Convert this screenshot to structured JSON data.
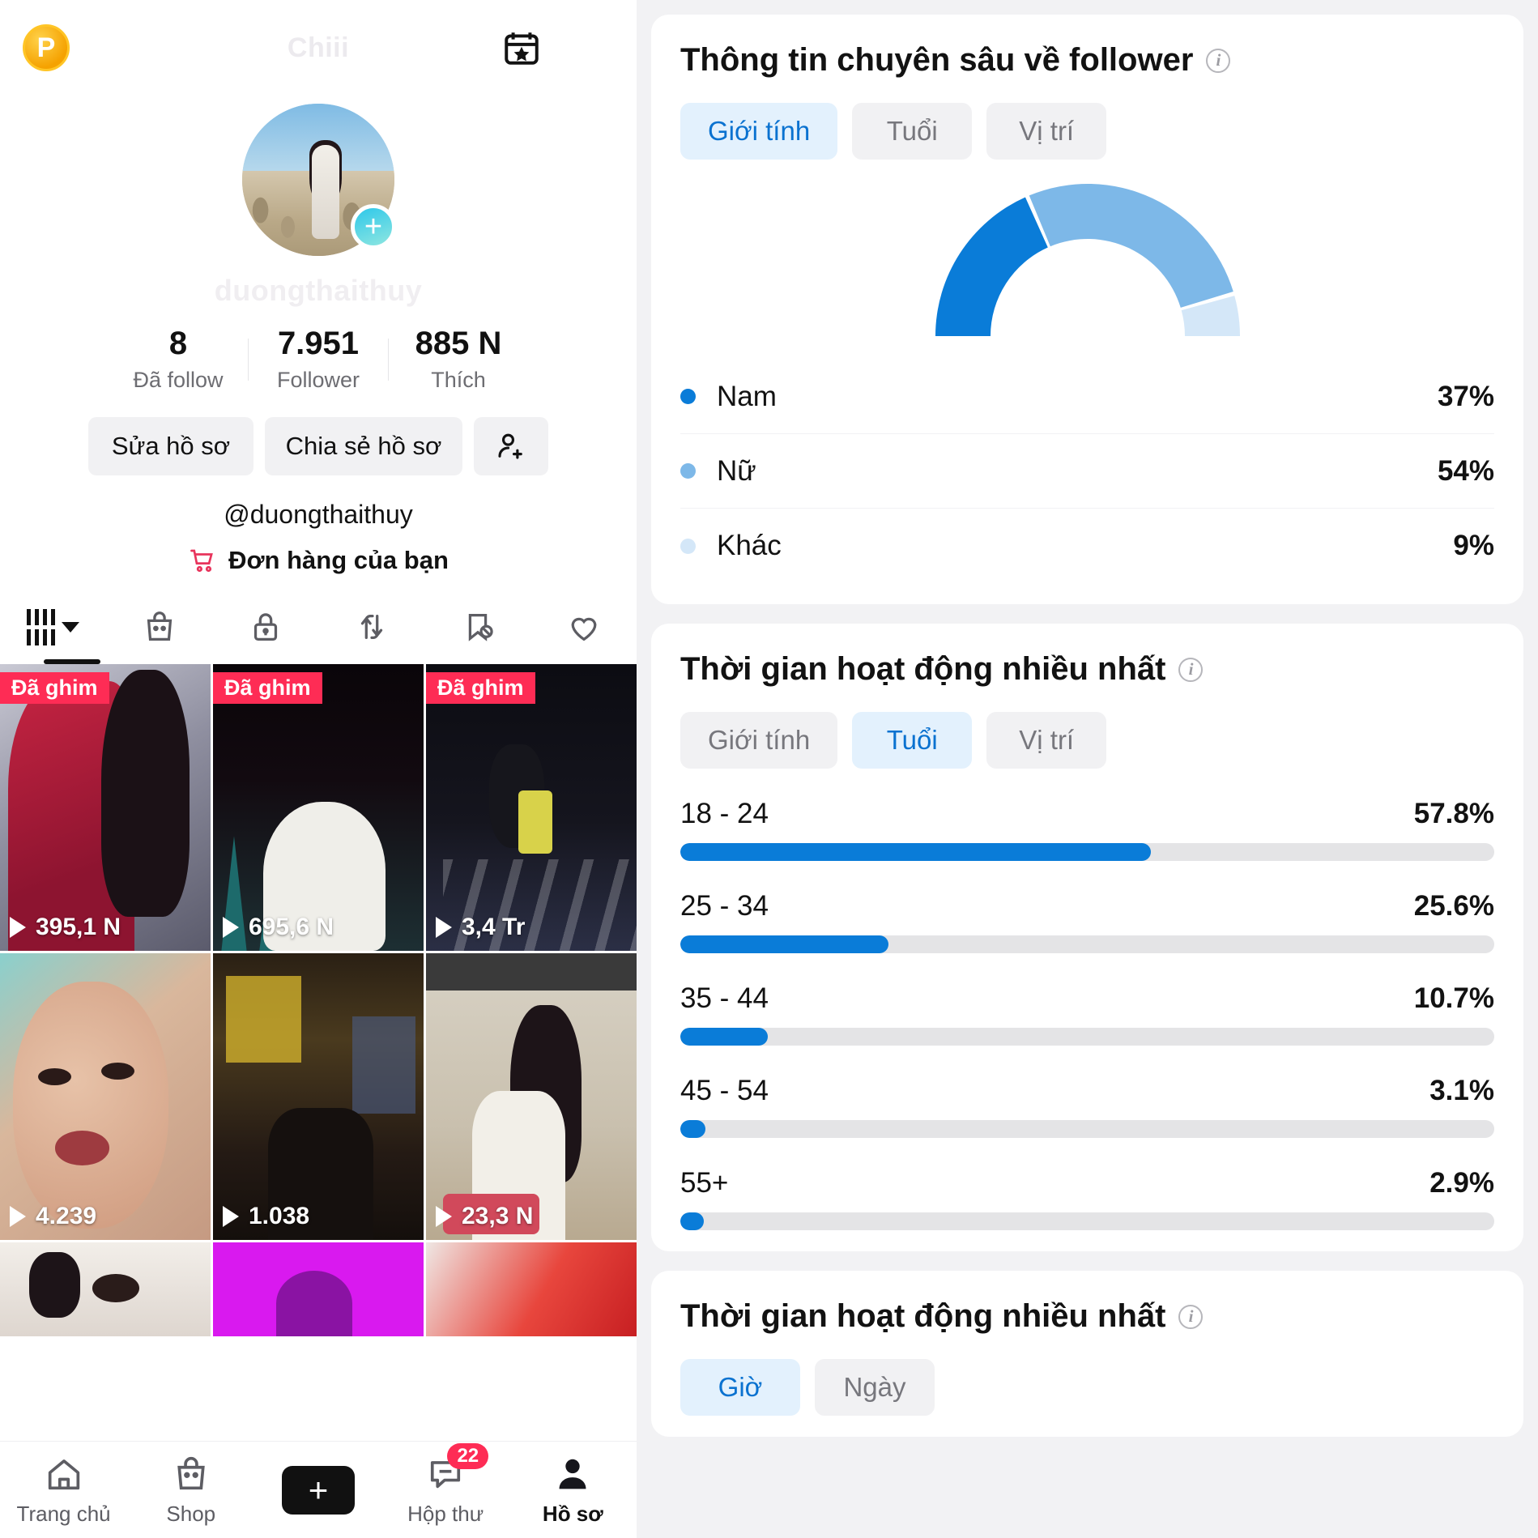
{
  "profile": {
    "topbar": {
      "coin_label": "P",
      "title": "Chiii",
      "calendar_icon": "calendar-star-icon",
      "menu_icon": "hamburger-menu-icon"
    },
    "avatar_icon": "profile-avatar",
    "add_story_icon": "plus-icon",
    "display_name": "duongthaithuy",
    "stats": [
      {
        "num": "8",
        "label": "Đã follow"
      },
      {
        "num": "7.951",
        "label": "Follower"
      },
      {
        "num": "885 N",
        "label": "Thích"
      }
    ],
    "buttons": {
      "edit": "Sửa hồ sơ",
      "share": "Chia sẻ hồ sơ",
      "add_user_icon": "add-user-icon"
    },
    "handle": "@duongthaithuy",
    "orders": {
      "icon": "shopping-cart-icon",
      "label": "Đơn hàng của bạn"
    },
    "tabs": [
      {
        "icon": "grid-videos-icon",
        "active": true
      },
      {
        "icon": "shop-bag-icon",
        "active": false
      },
      {
        "icon": "lock-private-icon",
        "active": false
      },
      {
        "icon": "repost-icon",
        "active": false
      },
      {
        "icon": "saved-hidden-icon",
        "active": false
      },
      {
        "icon": "heart-liked-icon",
        "active": false
      }
    ],
    "pinned_label": "Đã ghim",
    "videos": [
      {
        "pinned": true,
        "views": "395,1 N",
        "thumb": "stage-red-outfit"
      },
      {
        "pinned": true,
        "views": "695,6 N",
        "thumb": "dark-stage-white-top"
      },
      {
        "pinned": true,
        "views": "3,4 Tr",
        "thumb": "stage-dancers"
      },
      {
        "pinned": false,
        "views": "4.239",
        "thumb": "closeup-face"
      },
      {
        "pinned": false,
        "views": "1.038",
        "thumb": "street-night"
      },
      {
        "pinned": false,
        "views": "23,3 N",
        "thumb": "kitchen-apron"
      },
      {
        "pinned": false,
        "views": "",
        "thumb": "eyes-closeup"
      },
      {
        "pinned": false,
        "views": "",
        "thumb": "magenta-clip"
      },
      {
        "pinned": false,
        "views": "",
        "thumb": "red-clip"
      }
    ],
    "bottom_nav": [
      {
        "icon": "home-icon",
        "label": "Trang chủ",
        "badge": "",
        "active": false
      },
      {
        "icon": "shop-icon",
        "label": "Shop",
        "badge": "",
        "active": false
      },
      {
        "icon": "create-icon",
        "label": "",
        "badge": "",
        "active": false
      },
      {
        "icon": "inbox-icon",
        "label": "Hộp thư",
        "badge": "22",
        "active": false
      },
      {
        "icon": "profile-icon",
        "label": "Hồ sơ",
        "badge": "",
        "active": true
      }
    ]
  },
  "analytics": {
    "colors": {
      "accent": "#0a7cd8",
      "accent_light": "#7db8e8",
      "accent_pale": "#d4e7f8",
      "seg_active_bg": "#e3f1fd",
      "seg_active_text": "#0a72d0"
    },
    "follower_card": {
      "title": "Thông tin chuyên sâu về follower",
      "info_icon": "info-icon",
      "segments": [
        {
          "label": "Giới tính",
          "active": true
        },
        {
          "label": "Tuổi",
          "active": false
        },
        {
          "label": "Vị trí",
          "active": false
        }
      ]
    },
    "age_card": {
      "title": "Thời gian hoạt động nhiều nhất",
      "info_icon": "info-icon",
      "segments": [
        {
          "label": "Giới tính",
          "active": false
        },
        {
          "label": "Tuổi",
          "active": true
        },
        {
          "label": "Vị trí",
          "active": false
        }
      ]
    },
    "time_card": {
      "title": "Thời gian hoạt động nhiều nhất",
      "info_icon": "info-icon",
      "segments": [
        {
          "label": "Giờ",
          "active": true
        },
        {
          "label": "Ngày",
          "active": false
        }
      ]
    }
  },
  "chart_data": [
    {
      "type": "pie",
      "title": "Thông tin chuyên sâu về follower",
      "subtitle": "Giới tính",
      "variant": "half-donut-gauge",
      "legend_position": "below",
      "categories": [
        "Nam",
        "Nữ",
        "Khác"
      ],
      "values": [
        37,
        54,
        9
      ],
      "value_labels": [
        "37%",
        "54%",
        "9%"
      ],
      "colors": [
        "#0a7cd8",
        "#7db8e8",
        "#d4e7f8"
      ]
    },
    {
      "type": "bar",
      "orientation": "horizontal",
      "title": "Thời gian hoạt động nhiều nhất",
      "subtitle": "Tuổi",
      "xlabel": "",
      "ylabel": "",
      "xlim": [
        0,
        100
      ],
      "grid": false,
      "categories": [
        "18 - 24",
        "25 - 34",
        "35 - 44",
        "45 - 54",
        "55+"
      ],
      "values": [
        57.8,
        25.6,
        10.7,
        3.1,
        2.9
      ],
      "value_labels": [
        "57.8%",
        "25.6%",
        "10.7%",
        "3.1%",
        "2.9%"
      ],
      "bar_color": "#0a7cd8",
      "track_color": "#e4e4e6"
    }
  ]
}
